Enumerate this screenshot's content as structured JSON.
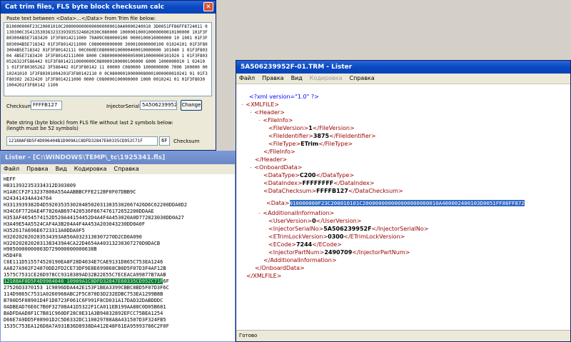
{
  "calc": {
    "title": "Cat trim files, FLS byte block checksum calc",
    "instruction": "Paste text between <Data>...</Data>  from Trim file below:",
    "data_text": "B10000000F23C20001010C2000000000000000000010A40000240010 3D0051FF86FF8724011 0130300C35413530363233393935324602030C080000 100000100010000000010100000 101F3F803004B5E7183420 1F3F8014211000 70A09C080000100 0000100010000000 10 1001 01F3F803004B5E718342 01F3F8014211000 C080000000000 300010000000100 01024101 01F3F803004B5E718342 01F3F80142111 00C060EC080000100000400010000000 101040 1 01F3F80304 4B5E7183420 1F3F80142111000 8000 C080000000000500010000000101024 1 01F3F8030526323F586442 01F3F80142110000000C080000100000100000 6000 1000000010 1 02410 1 01F3F80305262 3F586442 01F3F80142 11 00000 C080000 1000000000 7000 100000 0010241010 1F3F80301004201F3F80142110 0 0C080000100000080001000000010241 01 01F3F80302 2632420 1F3F8014211000 0000 C080000100000000 1000 0010241 01 01F3F8030 1004201F3F80142 1100",
    "checksum_label": "Checksum:",
    "checksum_value": "FFFFB127",
    "injector_label": "InjectorSerialNo",
    "injector_value": "5A506239952F",
    "change_button": "Change",
    "pate_instruction": "Pate string (byte block) from FLS file without last 2 symbols below:\n(length must be 52 symbols)",
    "pate_value": "12188AF8D5F4D9964048 1D909A1 C8DFD3 2847E 60335C D952 C71F",
    "pate_value_display": "12188AF8D5F4D996404B1D909A1C8DFD32847E60335CD952C71F",
    "checksum2_value": "6F",
    "checksum2_label": "Checksum"
  },
  "lister1": {
    "title": "Lister - [C:\\WINDOWS\\TEMP\\_tc\\1925341.fls]",
    "menu": [
      "Файл",
      "Правка",
      "Вид",
      "Кодировка",
      "Справка"
    ],
    "lines_before": [
      "HEFF",
      "H8313932353334312D303009",
      "H1A8CCF2F13237800A55AAABBBCFFE212BF0F07DBB9C",
      "H24341434A434764",
      "H3313939382D4D592035353020485020313835302067426D6C62200DDA0D2",
      "H34C6F7720AE4F7820AB697420536F667476172652200DDAAE",
      "H353AF4654574152D520A44154452D4A4F4A453020A0D772823030DD0A27",
      "H3A49E54A5524CAF4A3B204A4F4A453A203043230DD0A0F",
      "H352617A696E6723313A0DDA0F5",
      "H320202020203534393A850A0323130307270D2CD0A090",
      "H3202020202031383439A4CA22D4654A40313230307270D0DACB",
      "H9050000000003D729000000000638B",
      "H5D4F8",
      "C6E111D515574520190EA8F28D4034E7CAE9131D865C753EA1246",
      "AA827A902F24870DD2FD2CE73DF9E8E699868CB0D5F07D3F4AF12B",
      "1575C7531CE26D978CC9318389AD32B22E55C7ECEACA99877B7AAB"
    ],
    "highlight_line": "12188AF8D5F4D9964048 10909A1C8DFD32847E60335CD952C71F",
    "highlight_tail": "6F",
    "lines_after": [
      "27526D3370153 1C9896DDA442E153F1BEA3399CBBC8BD5F07D3F6C",
      "114D9865C7531A0260968ABC2F5C870D3D232EDBC753EA1299B8B",
      "B700D5F08901D4F1D8723F061C6F991F8CD031A17DAD32DABDDDC",
      "0ADBEAD76E6C7B0F32708A41D5322F1CA011EB199AA88C0D05B681",
      "BADFDAAD8F1C7B81C960DF28C0E31A3B94832892EFCC75BEA1254",
      "D66E7A9DD5F08901D2C5D6332DC110029788A8A431507D3F324FB5",
      "1535C753EA126D8A7A931B36D8938DA412E48F61EA95993786C2F0F"
    ]
  },
  "lister2": {
    "title": "5A506239952F-01.TRM - Lister",
    "menu": [
      "Файл",
      "Правка",
      "Вид",
      "Кодировка",
      "Справка"
    ],
    "status": "Готово",
    "xml": {
      "decl": "<?xml version=\"1.0\" ?>",
      "root_open": "<XMLFILE>",
      "header_open": "<Header>",
      "fileinfo_open": "<FileInfo>",
      "fileversion": {
        "open": "<FileVersion>",
        "value": "1",
        "close": "</FileVersion>"
      },
      "fileidentifier": {
        "open": "<FileIdentifier>",
        "value": "3875",
        "close": "</FileIdentifier>"
      },
      "filetype": {
        "open": "<FileType>",
        "value": "ETrim",
        "close": "</FileType>"
      },
      "fileinfo_close": "</FileInfo>",
      "header_close": "</Header>",
      "onboard_open": "<OnboardData>",
      "datatype": {
        "open": "<DataType>",
        "value": "C200",
        "close": "</DataType>"
      },
      "dataindex": {
        "open": "<DataIndex>",
        "value": "FFFFFFFF",
        "close": "</DataIndex>"
      },
      "datachecksum": {
        "open": "<DataChecksum>",
        "value": "FFFFB127",
        "close": "</DataChecksum>"
      },
      "data": {
        "open": "<Data>",
        "value": "010000000F23C200010101C200000000000000000000010A400002400103D0051FF86FF872"
      },
      "addinfo_open": "<AdditionalInformation>",
      "userversion": {
        "open": "<UserVersion>",
        "value": "0",
        "close": "</UserVersion>"
      },
      "injectorserial": {
        "open": "<InjectorSerialNo>",
        "value": "5A506239952F",
        "close": "</InjectorSerialNo>"
      },
      "etrimlock": {
        "open": "<ETrimLockVersion>",
        "value": "0300",
        "close": "</ETrimLockVersion>"
      },
      "ecode": {
        "open": "<ECode>",
        "value": "7244",
        "close": "</ECode>"
      },
      "injectorpart": {
        "open": "<InjectorPartNum>",
        "value": "2490709",
        "close": "</InjectorPartNum>"
      },
      "addinfo_close": "</AdditionalInformation>",
      "onboard_close": "</OnboardData>",
      "root_close": "</XMLFILE>"
    }
  }
}
